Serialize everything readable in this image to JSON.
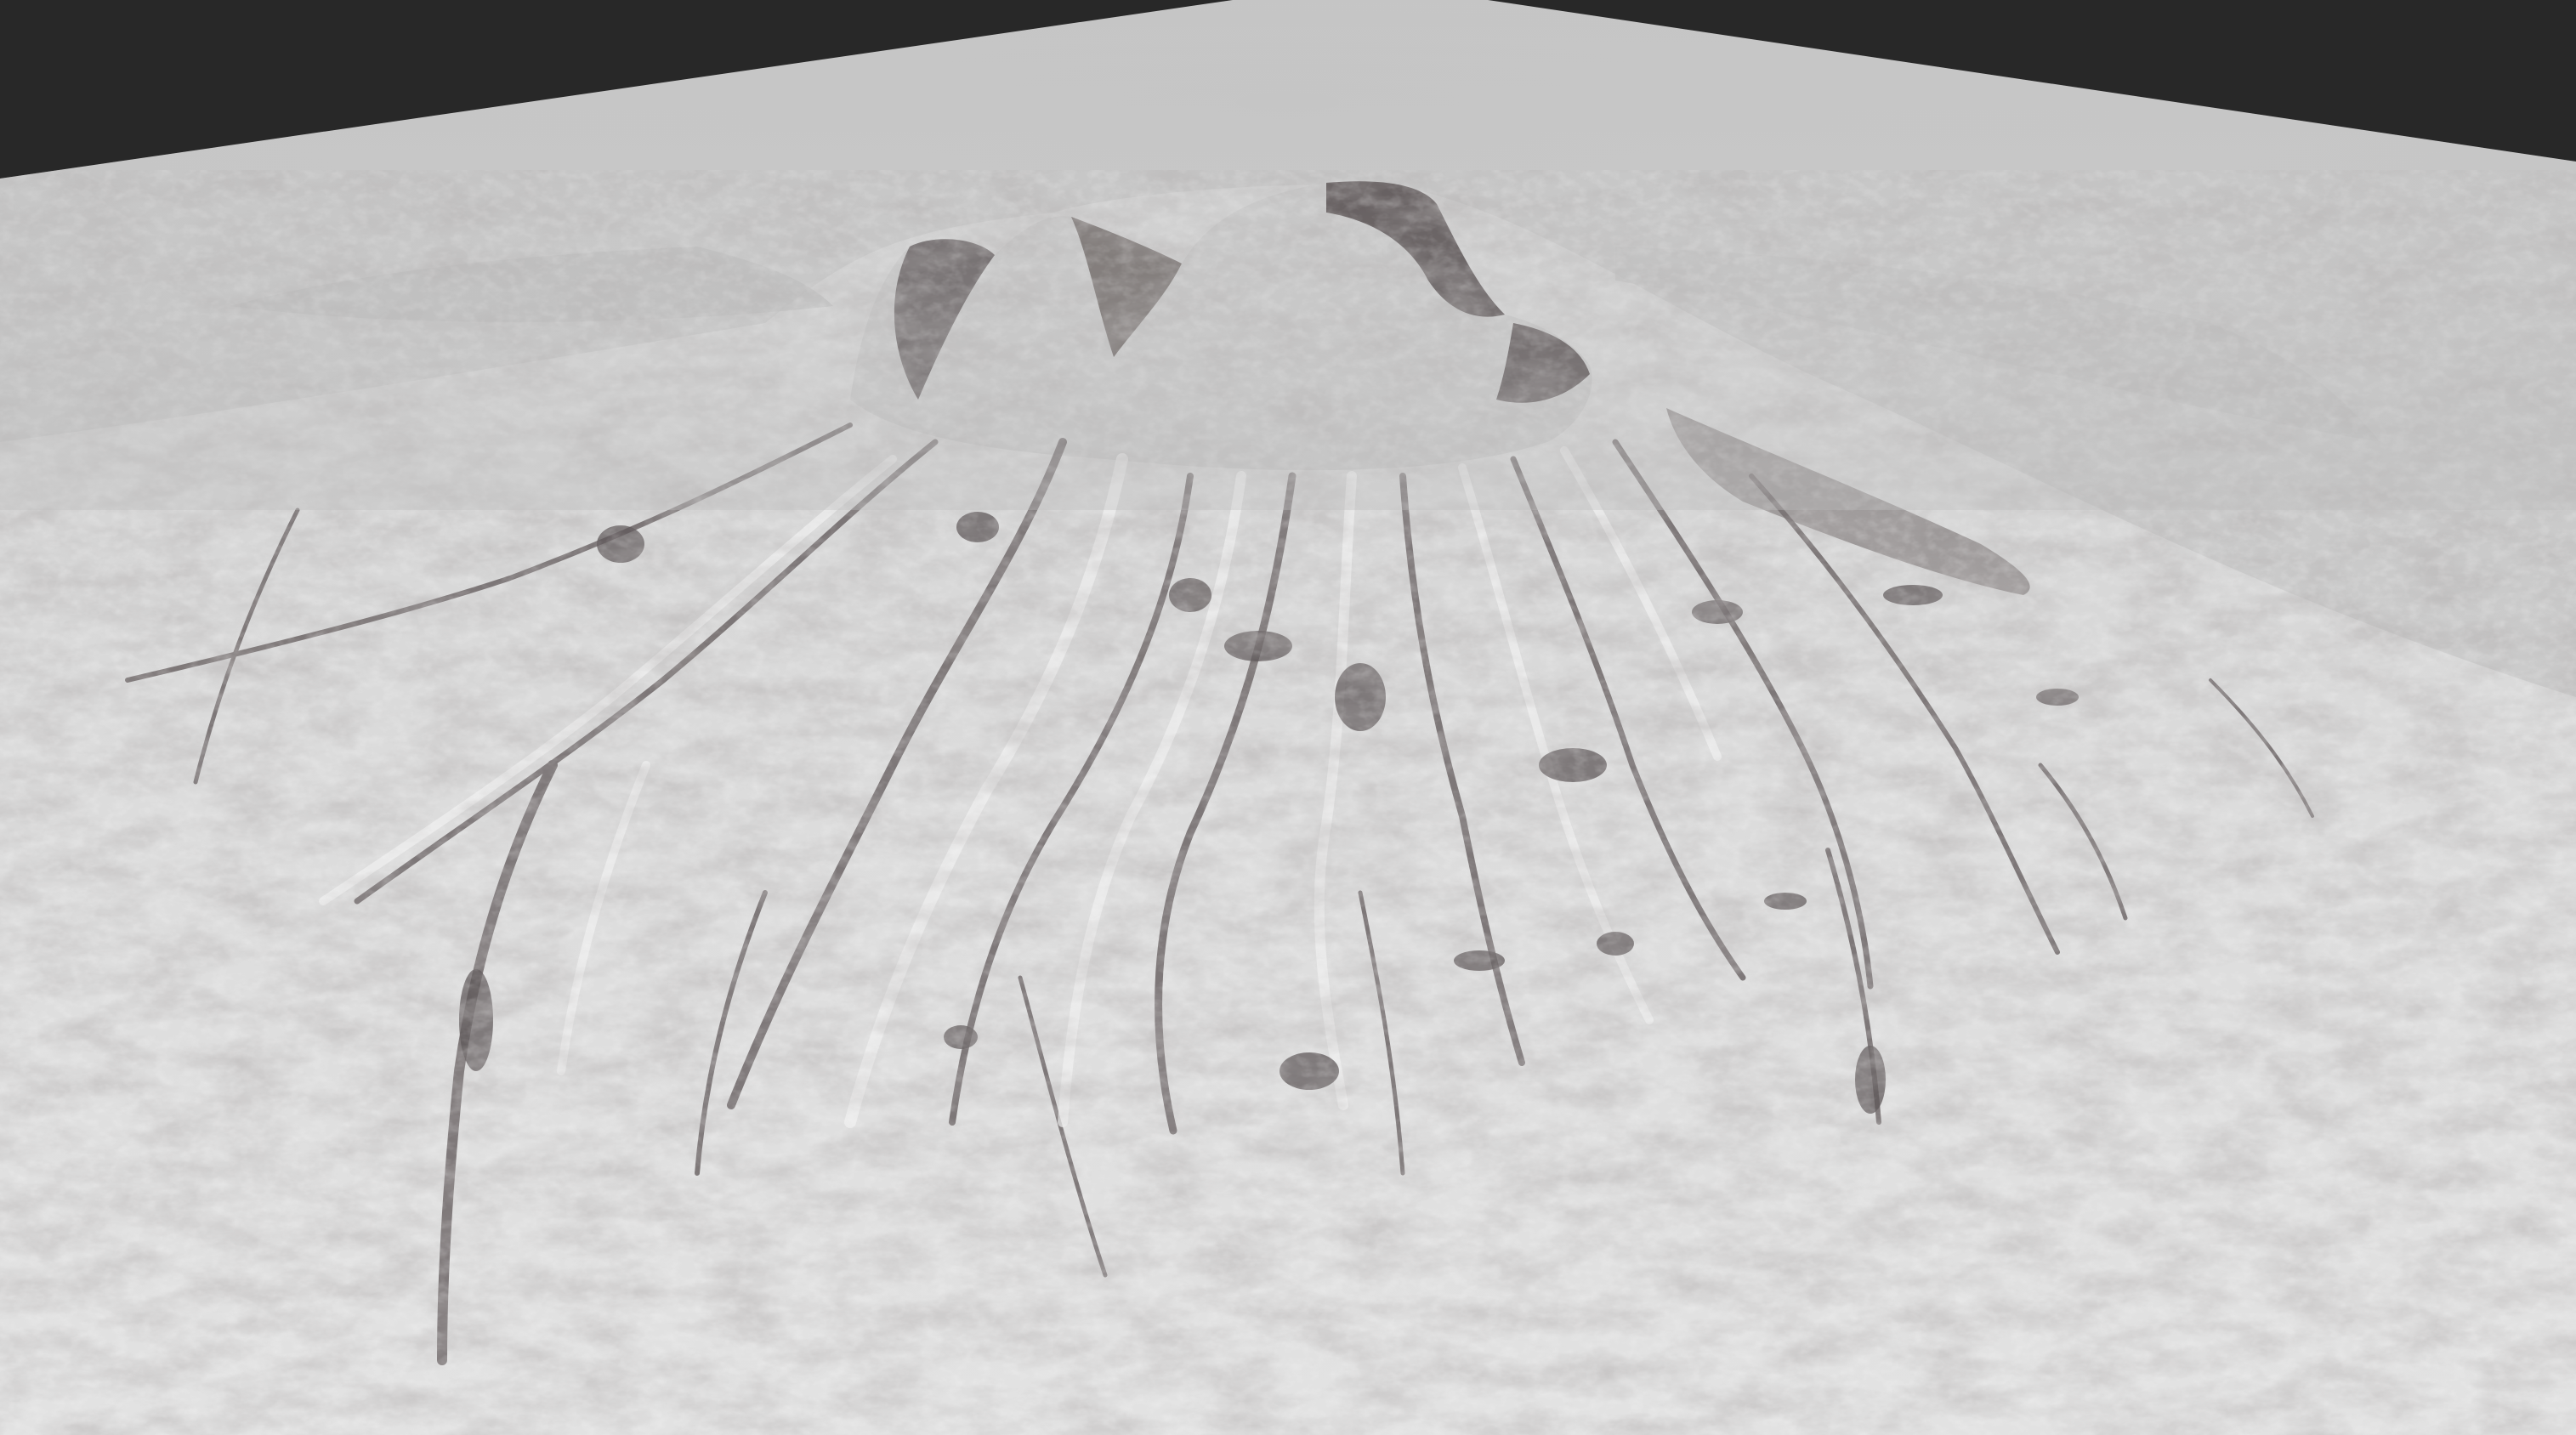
{
  "scene": {
    "background_color": "#282828",
    "plane_color": "#c2c2c2",
    "terrain_light_color": "#e6e6e6",
    "terrain_shadow_color": "#5b5556",
    "subject": "3d-terrain-render"
  }
}
